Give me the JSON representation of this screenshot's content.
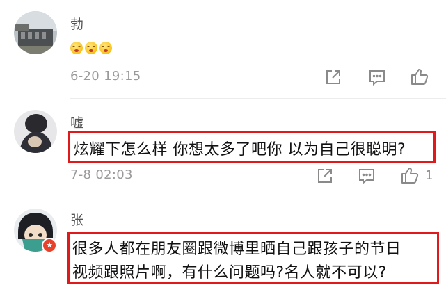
{
  "comments": [
    {
      "username": "勃",
      "emojis": [
        "flushed-emoji",
        "flushed-emoji",
        "flushed-emoji"
      ],
      "timestamp": "6-20 19:15",
      "like_count": ""
    },
    {
      "username": "嘘",
      "text": "炫耀下怎么样 你想太多了吧你 以为自己很聪明?",
      "timestamp": "7-8 02:03",
      "like_count": "1"
    },
    {
      "username": "张",
      "text_line1": "很多人都在朋友圈跟微博里晒自己跟孩子的节日",
      "text_line2": "视频跟照片啊，有什么问题吗?名人就不可以?"
    }
  ],
  "icons": {
    "share": "share-icon",
    "reply": "comment-icon",
    "like": "thumbs-up-icon",
    "badge": "verified-badge-icon"
  },
  "colors": {
    "highlight": "#e01a1a",
    "timestamp": "#9a9a9a",
    "icon": "#8a8a8a",
    "badge": "#e8412b"
  }
}
